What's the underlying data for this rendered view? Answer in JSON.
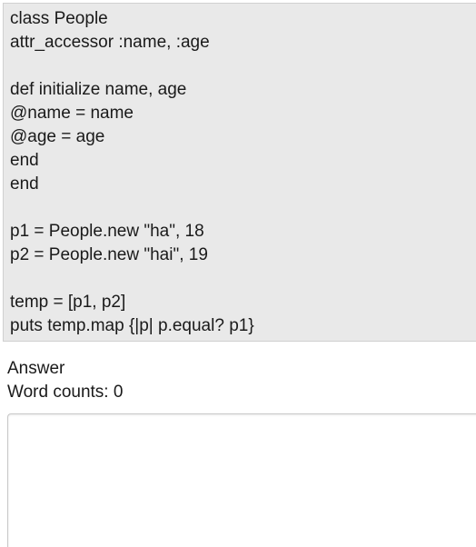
{
  "code": {
    "lines": [
      "class People",
      "attr_accessor :name, :age",
      "",
      "def initialize name, age",
      "@name = name",
      "@age = age",
      "end",
      "end",
      "",
      "p1 = People.new \"ha\", 18",
      "p2 = People.new \"hai\", 19",
      "",
      "temp = [p1, p2]",
      "puts temp.map {|p| p.equal? p1}"
    ]
  },
  "answer": {
    "label": "Answer",
    "word_counts_label": "Word counts:",
    "word_count": "0",
    "value": "",
    "placeholder": ""
  }
}
